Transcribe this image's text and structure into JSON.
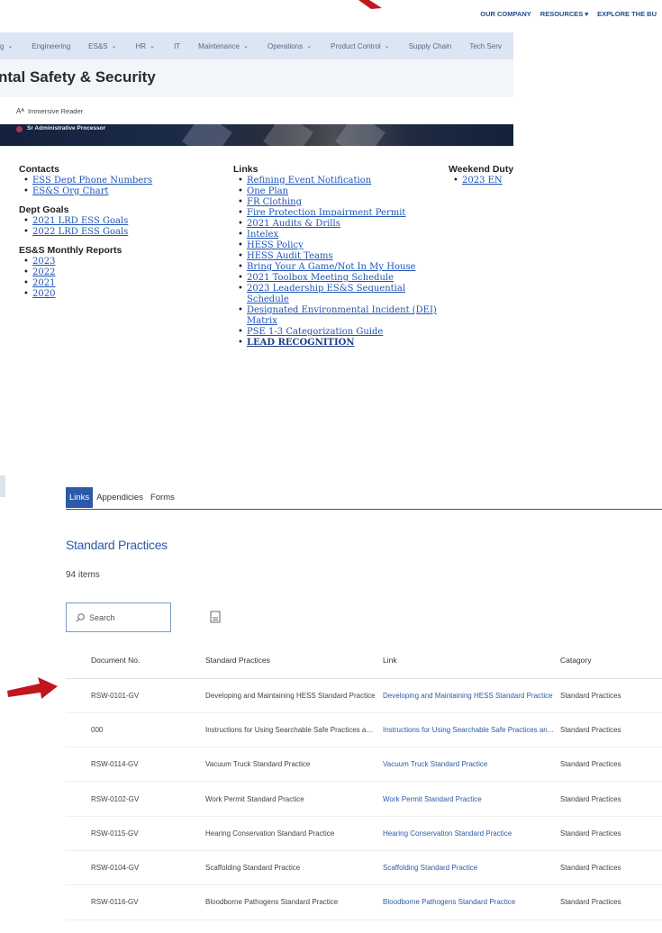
{
  "top_nav": {
    "links": [
      "OUR COMPANY",
      "RESOURCES ▾",
      "EXPLORE THE BU"
    ]
  },
  "menu": {
    "items": [
      {
        "label": "g",
        "has_dropdown": true
      },
      {
        "label": "Engineering",
        "has_dropdown": false
      },
      {
        "label": "ES&S",
        "has_dropdown": true
      },
      {
        "label": "HR",
        "has_dropdown": true
      },
      {
        "label": "IT",
        "has_dropdown": false
      },
      {
        "label": "Maintenance",
        "has_dropdown": true
      },
      {
        "label": "Operations",
        "has_dropdown": true
      },
      {
        "label": "Product Control",
        "has_dropdown": true
      },
      {
        "label": "Supply Chain",
        "has_dropdown": false
      },
      {
        "label": "Tech Serv",
        "has_dropdown": false
      }
    ]
  },
  "page_title": "ntal Safety & Security",
  "command_bar": {
    "immersive_reader": "Immersive Reader"
  },
  "banner": {
    "person_title": "Sr Administrative Processor"
  },
  "contacts": {
    "heading": "Contacts",
    "items": [
      "ESS Dept Phone Numbers",
      "ES&S Org Chart"
    ]
  },
  "dept_goals": {
    "heading": "Dept Goals",
    "items": [
      "2021 LRD ESS Goals",
      "2022 LRD ESS Goals"
    ]
  },
  "monthly_reports": {
    "heading": "ES&S Monthly Reports",
    "items": [
      "2023",
      "2022",
      "2021",
      "2020"
    ]
  },
  "links_column": {
    "heading": "Links",
    "items": [
      "Refining Event Notification",
      "One Plan",
      "FR Clothing",
      "Fire Protection Impairment Permit",
      "2021 Audits & Drills",
      "Intelex",
      "HESS Policy",
      "HESS Audit Teams",
      "Bring Your A Game/Not In My House",
      "2021 Toolbox Meeting Schedule",
      "2023 Leadership ES&S Sequential Schedule",
      "Designated Environmental Incident (DEI) Matrix",
      "PSE 1-3 Categorization Guide",
      "LEAD RECOGNITION"
    ]
  },
  "weekend_duty": {
    "heading": "Weekend Duty",
    "items": [
      "2023 EN"
    ]
  },
  "tabs": [
    "Links",
    "Appendicies",
    "Forms"
  ],
  "list": {
    "title": "Standard Practices",
    "count": "94 items",
    "search_placeholder": "Search",
    "columns": [
      "Document No.",
      "Standard Practices",
      "Link",
      "Catagory"
    ],
    "rows": [
      {
        "doc": "RSW-0101-GV",
        "practice": "Developing and Maintaining HESS Standard Practice",
        "link": "Developing and Maintaining HESS Standard Practice",
        "category": "Standard Practices"
      },
      {
        "doc": "000",
        "practice": "Instructions for Using Searchable Safe Practices and ...",
        "link": "Instructions for Using Searchable Safe Practices an...",
        "category": "Standard Practices"
      },
      {
        "doc": "RSW-0114-GV",
        "practice": "Vacuum Truck Standard Practice",
        "link": "Vacuum Truck Standard Practice",
        "category": "Standard Practices"
      },
      {
        "doc": "RSW-0102-GV",
        "practice": "Work Permit Standard Practice",
        "link": "Work Permit Standard Practice",
        "category": "Standard Practices"
      },
      {
        "doc": "RSW-0115-GV",
        "practice": "Hearing Conservation Standard Practice",
        "link": "Hearing Conservation Standard Practice",
        "category": "Standard Practices"
      },
      {
        "doc": "RSW-0104-GV",
        "practice": "Scaffolding Standard Practice",
        "link": "Scaffolding Standard Practice",
        "category": "Standard Practices"
      },
      {
        "doc": "RSW-0116-GV",
        "practice": "Bloodborne Pathogens Standard Practice",
        "link": "Bloodborne Pathogens Standard Practice",
        "category": "Standard Practices"
      }
    ]
  },
  "colors": {
    "accent": "#2d5aa8",
    "menu_bg": "#dbe5f3",
    "link": "#1f54b8",
    "annotation_arrow": "#c0161e"
  }
}
